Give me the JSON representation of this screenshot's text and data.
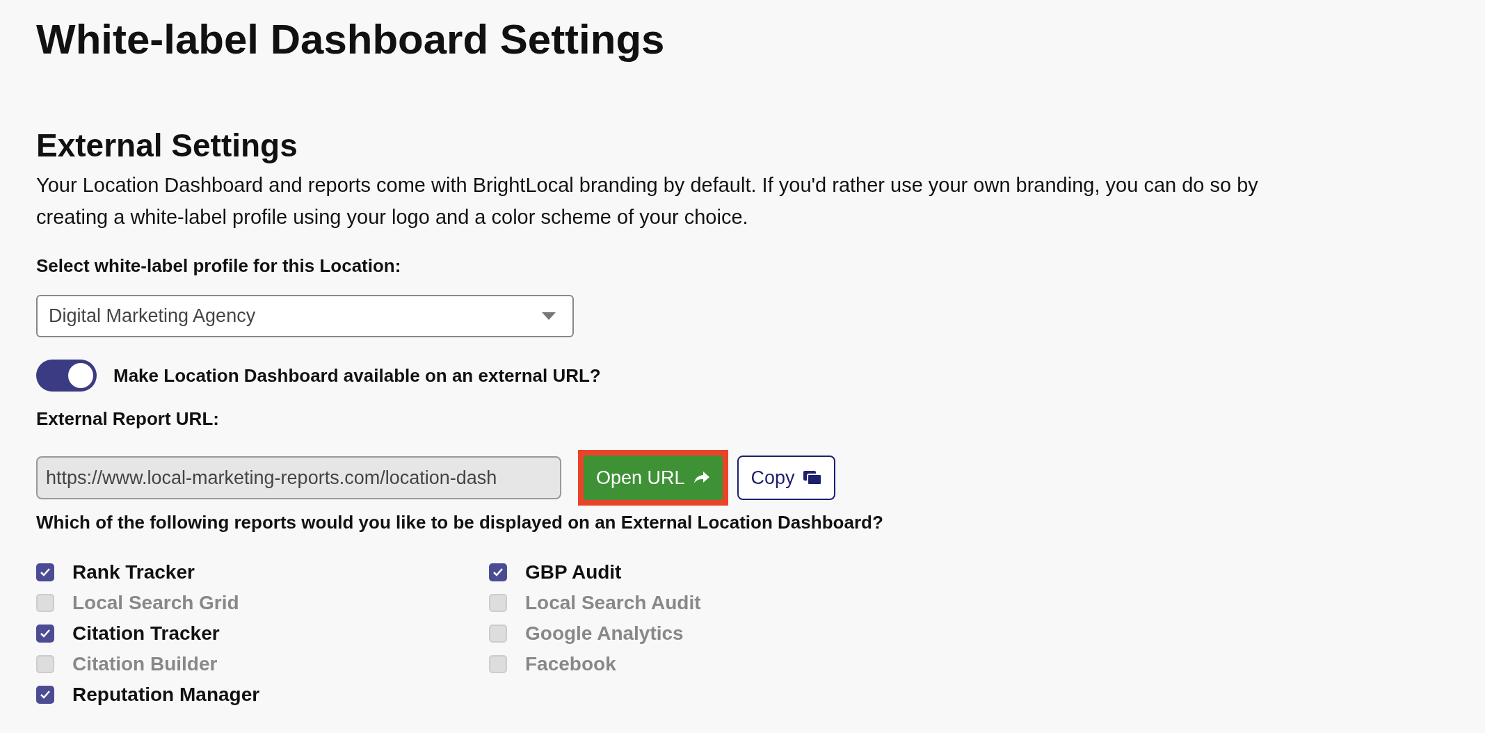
{
  "page_title": "White-label Dashboard Settings",
  "section": {
    "title": "External Settings",
    "description": "Your Location Dashboard and reports come with BrightLocal branding by default. If you'd rather use your own branding, you can do so by creating a white-label profile using your logo and a color scheme of your choice."
  },
  "profile_select": {
    "label": "Select white-label profile for this Location:",
    "value": "Digital Marketing Agency"
  },
  "external_toggle": {
    "label": "Make Location Dashboard available on an external URL?",
    "on": true
  },
  "external_url": {
    "label": "External Report URL:",
    "value": "https://www.local-marketing-reports.com/location-dash"
  },
  "buttons": [
    {
      "label": "Open URL",
      "kind": "primary",
      "highlighted": true
    },
    {
      "label": "Copy",
      "kind": "outline",
      "highlighted": false
    }
  ],
  "reports": {
    "question": "Which of the following reports would you like to be displayed on an External Location Dashboard?",
    "columns": [
      [
        {
          "label": "Rank Tracker",
          "checked": true
        },
        {
          "label": "Local Search Grid",
          "checked": false
        },
        {
          "label": "Citation Tracker",
          "checked": true
        },
        {
          "label": "Citation Builder",
          "checked": false
        },
        {
          "label": "Reputation Manager",
          "checked": true
        }
      ],
      [
        {
          "label": "GBP Audit",
          "checked": true
        },
        {
          "label": "Local Search Audit",
          "checked": false
        },
        {
          "label": "Google Analytics",
          "checked": false
        },
        {
          "label": "Facebook",
          "checked": false
        }
      ]
    ]
  }
}
